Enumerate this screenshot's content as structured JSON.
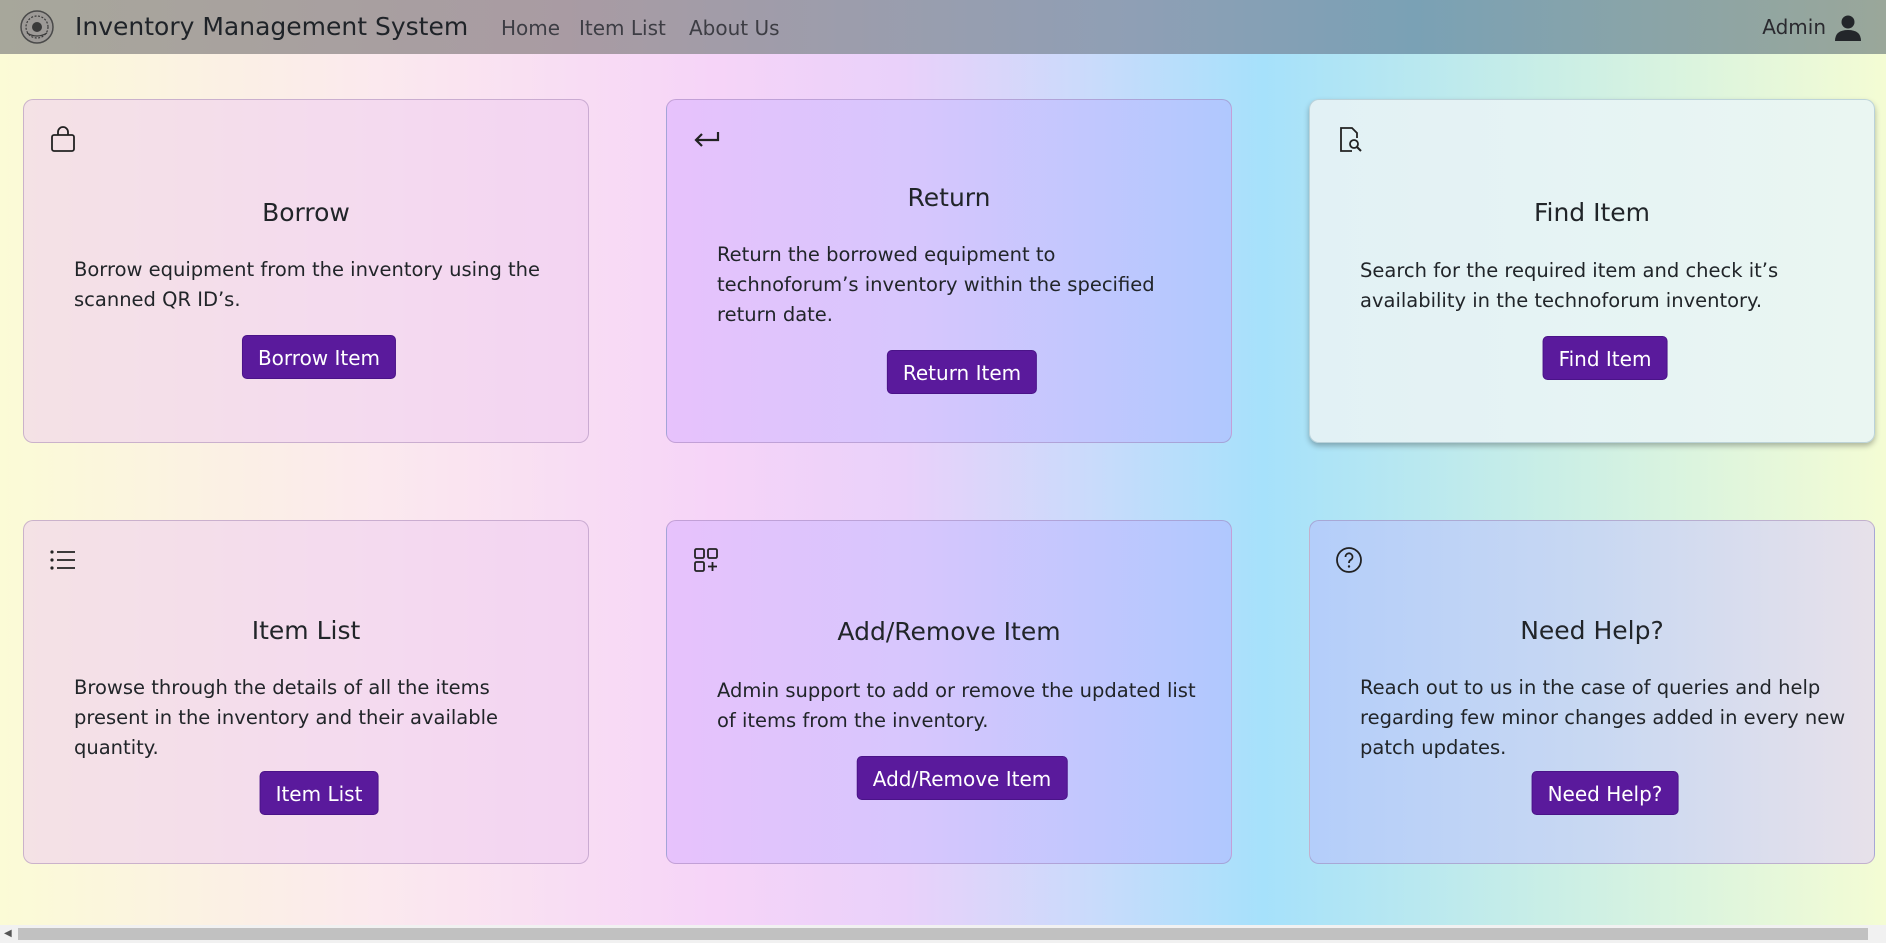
{
  "navbar": {
    "brand": "Inventory Management System",
    "links": [
      "Home",
      "Item List",
      "About Us"
    ],
    "user_label": "Admin"
  },
  "cards": [
    {
      "icon": "bag-icon",
      "title": "Borrow",
      "text": "Borrow equipment from the inventory using the scanned QR ID’s.",
      "button": "Borrow Item"
    },
    {
      "icon": "return-arrow-icon",
      "title": "Return",
      "text": "Return the borrowed equipment to technoforum’s inventory within the specified return date.",
      "button": "Return Item"
    },
    {
      "icon": "file-search-icon",
      "title": "Find Item",
      "text": "Search for the required item and check it’s availability in the technoforum inventory.",
      "button": "Find Item"
    },
    {
      "icon": "list-icon",
      "title": "Item List",
      "text": "Browse through the details of all the items present in the inventory and their available quantity.",
      "button": "Item List"
    },
    {
      "icon": "grid-plus-icon",
      "title": "Add/Remove Item",
      "text": "Admin support to add or remove the updated list of items from the inventory.",
      "button": "Add/Remove Item"
    },
    {
      "icon": "question-circle-icon",
      "title": "Need Help?",
      "text": "Reach out to us in the case of queries and help regarding few minor changes added in every new patch updates.",
      "button": "Need Help?"
    }
  ],
  "colors": {
    "button": "#5a1a9c",
    "button_text": "#ffffff"
  }
}
